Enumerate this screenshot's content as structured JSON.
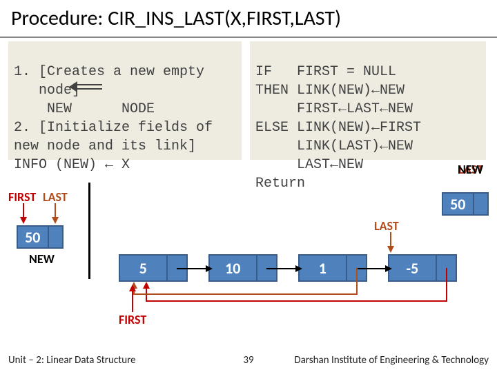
{
  "title": "Procedure: CIR_INS_LAST(X,FIRST,LAST)",
  "code_left": {
    "l1": "1. [Creates a new empty",
    "l2": "   node]",
    "l3_a": "    NEW",
    "l3_b": "NODE",
    "l4": "2. [Initialize fields of",
    "l5": "new node and its link]",
    "l6": "INFO (NEW) ← X"
  },
  "code_right": {
    "l1": "IF   FIRST = NULL",
    "l2": "THEN LINK(NEW)←NEW",
    "l3": "     FIRST←LAST←NEW",
    "l4": "ELSE LINK(NEW)←FIRST",
    "l5": "     LINK(LAST)←NEW",
    "l6": "     LAST←NEW",
    "l7": "Return"
  },
  "labels": {
    "last_top": "LAST",
    "new_top": "NEW",
    "first": "FIRST",
    "last": "LAST",
    "new": "NEW",
    "last_mid": "LAST",
    "first_bottom": "FIRST"
  },
  "nodes": {
    "n50a": "50",
    "n50b": "50",
    "n5": "5",
    "n10": "10",
    "n1": "1",
    "nm5": "-5"
  },
  "footer": {
    "left": "Unit – 2: Linear Data Structure",
    "page": "39",
    "right": "Darshan Institute of Engineering & Technology"
  }
}
